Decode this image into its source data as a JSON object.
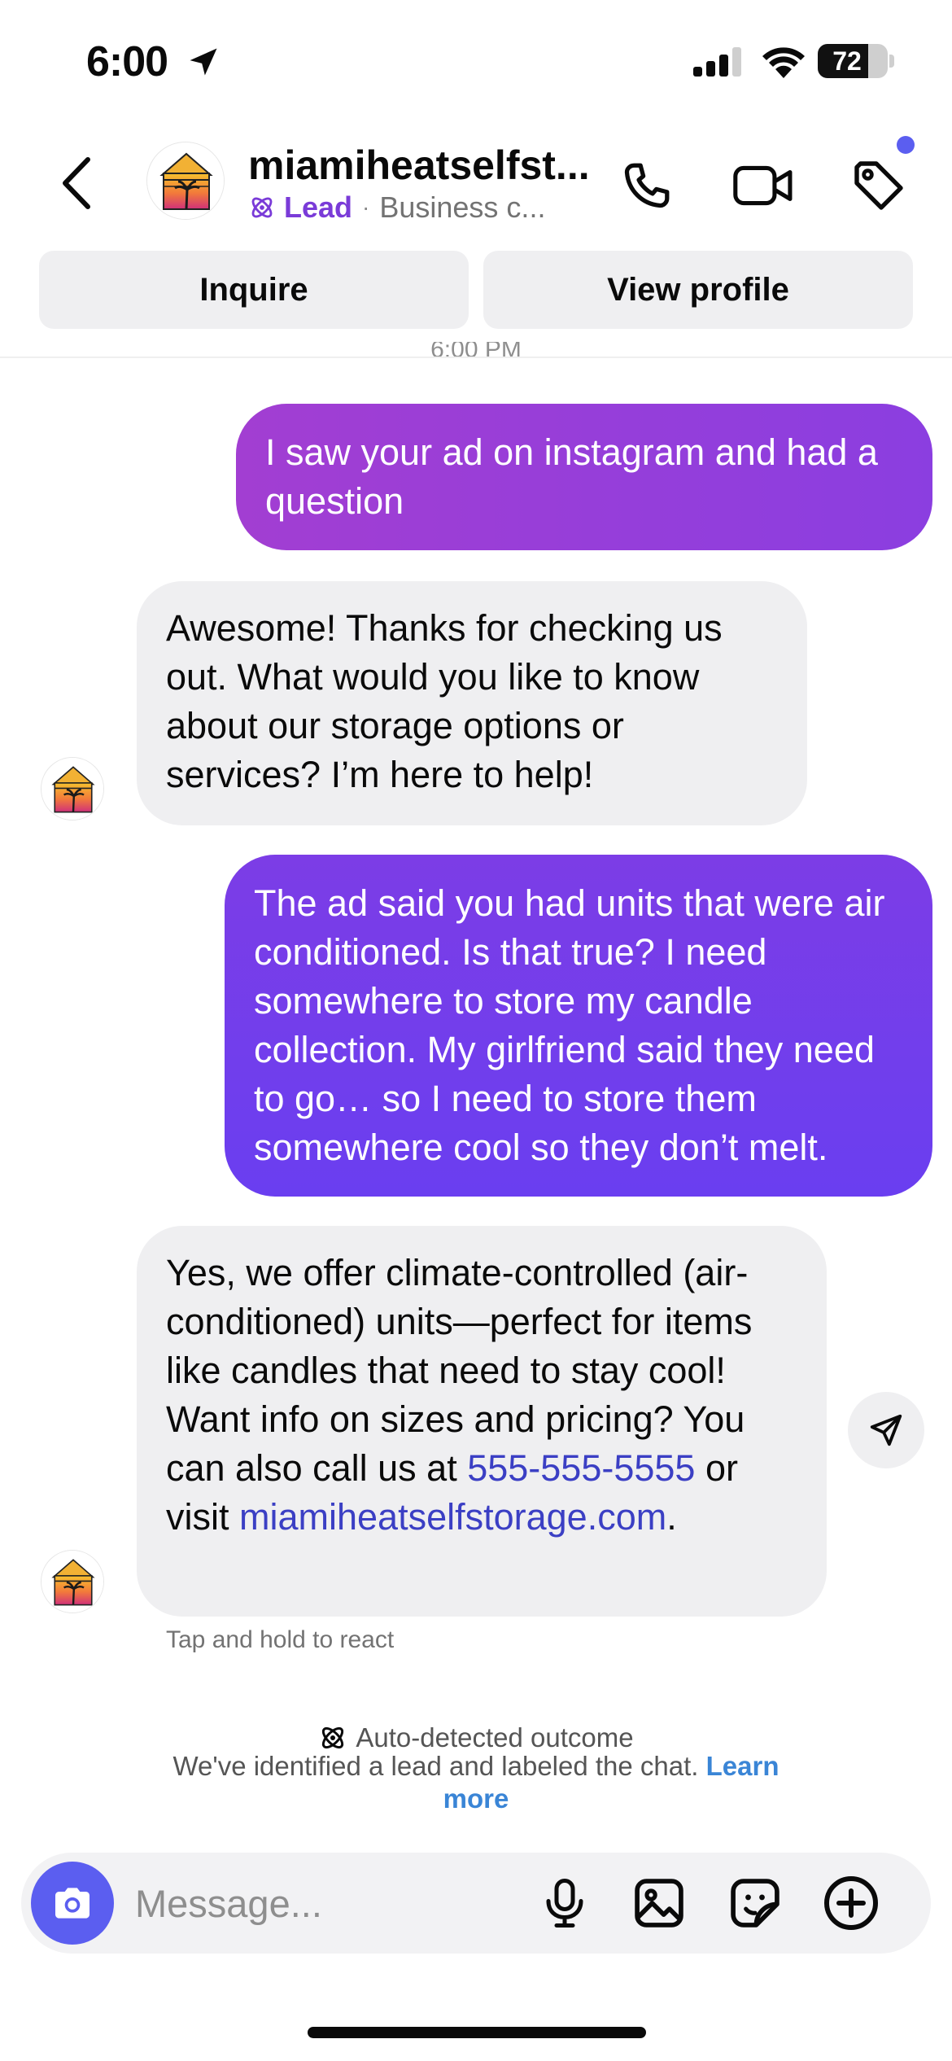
{
  "status_bar": {
    "time": "6:00",
    "battery": "72",
    "battery_level": 0.72
  },
  "header": {
    "contact_name": "miamiheatselfst...",
    "lead_label": "Lead",
    "separator": "·",
    "subtitle": "Business c...",
    "icons": [
      "back-icon",
      "phone-icon",
      "video-icon",
      "tag-icon"
    ]
  },
  "actions": {
    "inquire": "Inquire",
    "view_profile": "View profile"
  },
  "conversation": {
    "cut_timestamp": "6:00 PM",
    "messages": [
      {
        "from": "me",
        "text": "I saw your ad on instagram and had a question"
      },
      {
        "from": "business",
        "text": "Awesome! Thanks for checking us out. What would you like to know about our storage options or services? I’m here to help!"
      },
      {
        "from": "me",
        "text": "The ad said you had units that were air conditioned. Is that true? I need somewhere to store my candle collection. My girlfriend said they need to go… so I need to store them somewhere cool so they don’t melt."
      },
      {
        "from": "business",
        "text_before": "Yes, we offer climate-controlled (air-conditioned) units—perfect for items like candles that need to stay cool! Want info on sizes and pricing? You can also call us at ",
        "phone": "555-555-5555",
        "text_middle": " or visit ",
        "website": "miamiheatselfstorage.com",
        "text_after": "."
      }
    ],
    "react_hint": "Tap and hold to react"
  },
  "outcome": {
    "title": "Auto-detected outcome",
    "body": "We've identified a lead and labeled the chat. ",
    "learn_more": "Learn more"
  },
  "composer": {
    "placeholder": "Message...",
    "icons": [
      "camera-icon",
      "mic-icon",
      "gallery-icon",
      "sticker-icon",
      "plus-icon"
    ]
  },
  "colors": {
    "accent": "#5b5ef0",
    "lead_purple": "#7a3bd8",
    "outgoing_1": "#9b3ed6",
    "outgoing_2": "#7040ea",
    "incoming_bg": "#efeff1",
    "link": "#3b3fc4",
    "learn_more": "#3a85d6"
  }
}
